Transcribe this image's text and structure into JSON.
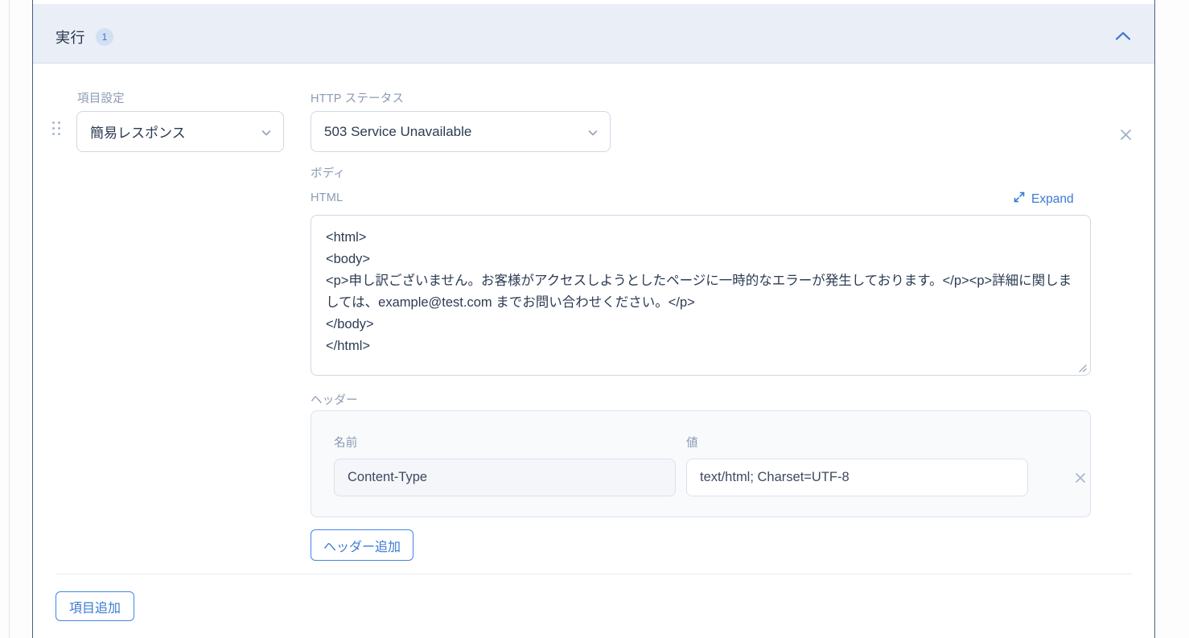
{
  "panel": {
    "title": "実行",
    "badge": "1",
    "collapse_icon": "chevron-up-icon",
    "remove_icon": "close-icon"
  },
  "item": {
    "drag_handle_icon": "drag-handle-icon",
    "type": {
      "label": "項目設定",
      "value": "簡易レスポンス",
      "caret_icon": "chevron-down-icon",
      "options": [
        "簡易レスポンス"
      ]
    },
    "http_status": {
      "label": "HTTP ステータス",
      "value": "503 Service Unavailable",
      "caret_icon": "chevron-down-icon",
      "options": [
        "503 Service Unavailable"
      ]
    },
    "body": {
      "label": "ボディ",
      "format_label": "HTML",
      "expand_label": "Expand",
      "expand_icon": "expand-arrows-icon",
      "resize_icon": "resize-grip-icon",
      "content": "<html>\n<body>\n<p>申し訳ございません。お客様がアクセスしようとしたページに一時的なエラーが発生しております。</p><p>詳細に関しましては、example@test.com までお問い合わせください。</p>\n</body>\n</html>"
    },
    "headers": {
      "label": "ヘッダー",
      "columns": {
        "name": "名前",
        "value": "値"
      },
      "rows": [
        {
          "name": "Content-Type",
          "value": "text/html; Charset=UTF-8",
          "remove_icon": "close-icon"
        }
      ],
      "add_button": "ヘッダー追加"
    }
  },
  "footer": {
    "add_item_button": "項目追加"
  },
  "colors": {
    "header_bg": "#e9eef7",
    "accent": "#3a7bd5",
    "badge_bg": "#d3e0f3",
    "badge_text": "#3f74c4",
    "label": "#8a9ab2",
    "text": "#2c3b52",
    "border": "#cfd8e5"
  }
}
